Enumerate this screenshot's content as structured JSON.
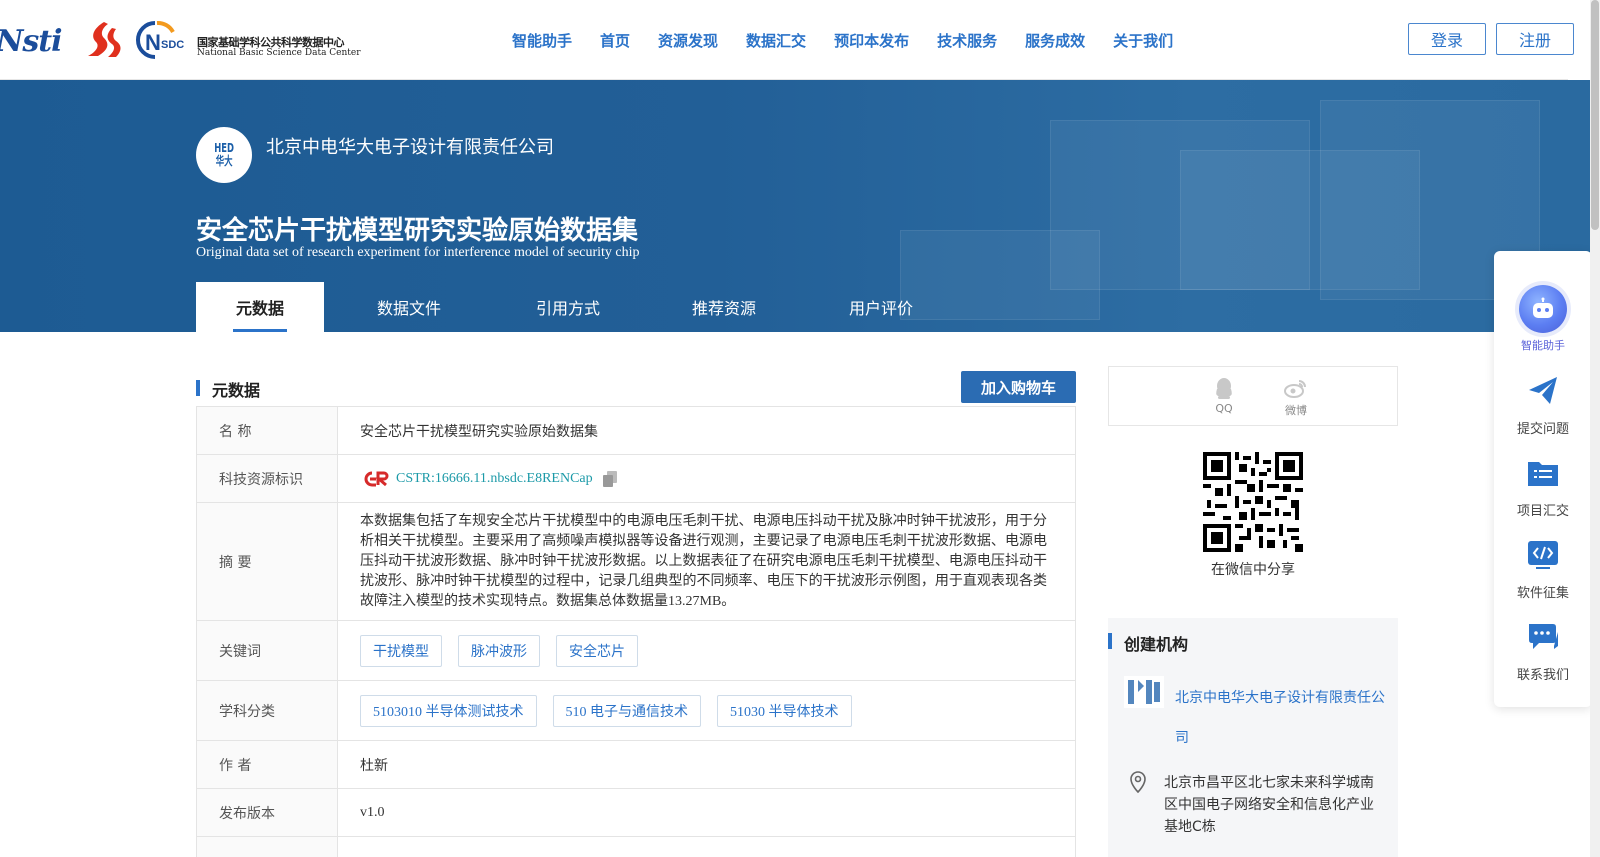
{
  "header": {
    "logo_nsti": "Nsti",
    "logo_nsdc_cn": "国家基础学科公共科学数据中心",
    "logo_nsdc_en": "National Basic Science Data Center",
    "nav": [
      "智能助手",
      "首页",
      "资源发现",
      "数据汇交",
      "预印本发布",
      "技术服务",
      "服务成效",
      "关于我们"
    ],
    "login": "登录",
    "register": "注册"
  },
  "banner": {
    "org_name": "北京中电华大电子设计有限责任公司",
    "title": "安全芯片干扰模型研究实验原始数据集",
    "title_en": "Original data set of research experiment for interference model of security chip",
    "tabs": [
      "元数据",
      "数据文件",
      "引用方式",
      "推荐资源",
      "用户评价"
    ]
  },
  "metadata": {
    "section_title": "元数据",
    "cart_button": "加入购物车",
    "rows": {
      "name_label": "名 称",
      "name_value": "安全芯片干扰模型研究实验原始数据集",
      "id_label": "科技资源标识",
      "id_value": "CSTR:16666.11.nbsdc.E8RENCap",
      "abstract_label": "摘 要",
      "abstract_value": "本数据集包括了车规安全芯片干扰模型中的电源电压毛刺干扰、电源电压抖动干扰及脉冲时钟干扰波形，用于分析相关干扰模型。主要采用了高频噪声模拟器等设备进行观测，主要记录了电源电压毛刺干扰波形数据、电源电压抖动干扰波形数据、脉冲时钟干扰波形数据。以上数据表征了在研究电源电压毛刺干扰模型、电源电压抖动干扰波形、脉冲时钟干扰模型的过程中，记录几组典型的不同频率、电压下的干扰波形示例图，用于直观表现各类故障注入模型的技术实现特点。数据集总体数据量13.27MB。",
      "keywords_label": "关键词",
      "keywords": [
        "干扰模型",
        "脉冲波形",
        "安全芯片"
      ],
      "subject_label": "学科分类",
      "subjects": [
        "5103010 半导体测试技术",
        "510 电子与通信技术",
        "51030 半导体技术"
      ],
      "author_label": "作 者",
      "author_value": "杜新",
      "version_label": "发布版本",
      "version_value": "v1.0"
    }
  },
  "share": {
    "qq": "QQ",
    "weibo": "微博",
    "wechat_caption": "在微信中分享"
  },
  "org_panel": {
    "title": "创建机构",
    "org_name": "北京中电华大电子设计有限责任公司",
    "address": "北京市昌平区北七家未来科学城南区中国电子网络安全和信息化产业基地C栋"
  },
  "float_bar": {
    "ai": "智能助手",
    "submit": "提交问题",
    "project": "项目汇交",
    "software": "软件征集",
    "contact": "联系我们"
  },
  "colors": {
    "primary": "#2b73c9",
    "banner": "#1d5b93",
    "cstr": "#1c9aa8"
  }
}
